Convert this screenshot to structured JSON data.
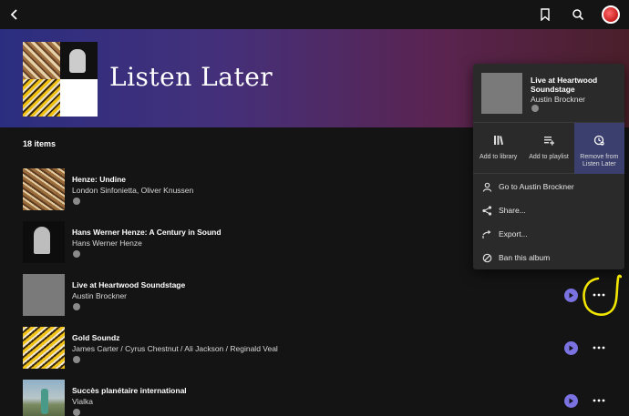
{
  "header": {
    "back_icon": "chevron-left-icon",
    "icons": [
      "bookmark-icon",
      "search-icon",
      "avatar"
    ]
  },
  "hero": {
    "title": "Listen Later",
    "gradient": [
      "#2b2e80",
      "#5a2450",
      "#4a1f2a"
    ]
  },
  "list": {
    "count_label": "18 items",
    "rows": [
      {
        "title": "Henze: Undine",
        "artist": "London Sinfonietta, Oliver Knussen",
        "art": "art-undine",
        "show_actions": false
      },
      {
        "title": "Hans Werner Henze: A Century in Sound",
        "artist": "Hans Werner Henze",
        "art": "art-century",
        "show_actions": false
      },
      {
        "title": "Live at Heartwood Soundstage",
        "artist": "Austin Brockner",
        "art": "art-grey",
        "show_actions": true
      },
      {
        "title": "Gold Soundz",
        "artist": "James Carter / Cyrus Chestnut / Ali Jackson / Reginald Veal",
        "art": "art-gold",
        "show_actions": true
      },
      {
        "title": "Succès planétaire international",
        "artist": "Vialka",
        "art": "art-vialka",
        "show_actions": true
      }
    ]
  },
  "context_menu": {
    "album_title": "Live at Heartwood Soundstage",
    "album_artist": "Austin Brockner",
    "actions": [
      {
        "label": "Add to library",
        "icon": "library-icon",
        "active": false
      },
      {
        "label": "Add to playlist",
        "icon": "playlist-add-icon",
        "active": false
      },
      {
        "label": "Remove from Listen Later",
        "icon": "clock-remove-icon",
        "active": true
      }
    ],
    "items": [
      {
        "label": "Go to Austin Brockner",
        "icon": "person-icon"
      },
      {
        "label": "Share...",
        "icon": "share-icon"
      },
      {
        "label": "Export...",
        "icon": "export-icon"
      },
      {
        "label": "Ban this album",
        "icon": "ban-icon"
      }
    ]
  },
  "colors": {
    "accent": "#7a72e0",
    "annotation": "#f2e600",
    "active_action_bg": "#3b3f6e"
  }
}
